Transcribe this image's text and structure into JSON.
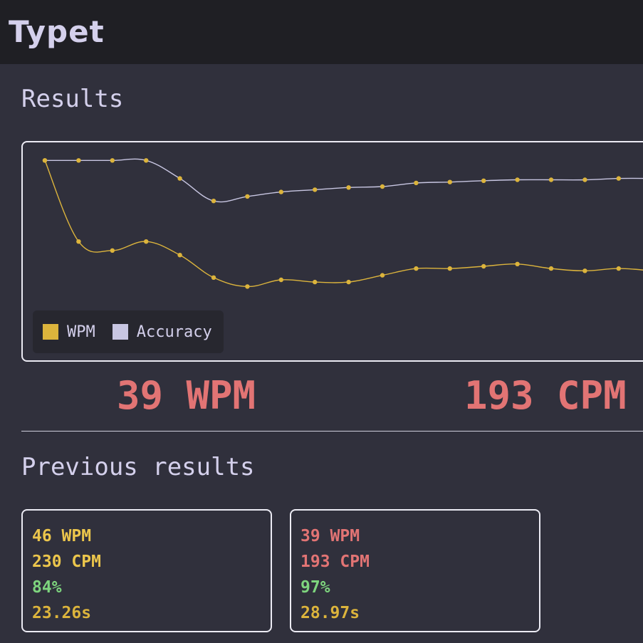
{
  "app": {
    "title": "Typet"
  },
  "results": {
    "title": "Results",
    "wpm_text": "39 WPM",
    "cpm_text": "193 CPM"
  },
  "colors": {
    "wpm": "#dcb43c",
    "accuracy": "#c8c6e2",
    "stat_red": "#e27474",
    "stat_yellow": "#ecc64c",
    "accuracy_green": "#7ed57e",
    "time_gold": "#dcb43c"
  },
  "chart_data": {
    "type": "line",
    "x": [
      1,
      2,
      3,
      4,
      5,
      6,
      7,
      8,
      9,
      10,
      11,
      12,
      13,
      14,
      15,
      16,
      17,
      18,
      19
    ],
    "series": [
      {
        "name": "Accuracy",
        "color": "#c8c6e2",
        "values": [
          100,
          100,
          100,
          100,
          96,
          91,
          92,
          93,
          93.5,
          94,
          94.2,
          95,
          95.2,
          95.5,
          95.7,
          95.7,
          95.7,
          96,
          96
        ]
      },
      {
        "name": "WPM",
        "color": "#dcb43c",
        "values": [
          100,
          82,
          80,
          82,
          79,
          74,
          72,
          73.5,
          73,
          73,
          74.5,
          76,
          76,
          76.5,
          77,
          76,
          75.5,
          76,
          75.5
        ]
      }
    ],
    "ylim": [
      55,
      104
    ],
    "legend": [
      {
        "label": "WPM",
        "color": "#dcb43c"
      },
      {
        "label": "Accuracy",
        "color": "#c8c6e2"
      }
    ],
    "legend_position": "bottom-left",
    "grid": false
  },
  "previous": {
    "title": "Previous results",
    "cards": [
      {
        "wpm": "46 WPM",
        "cpm": "230 CPM",
        "accuracy": "84%",
        "time": "23.26s",
        "speed_color": "#ecc64c"
      },
      {
        "wpm": "39 WPM",
        "cpm": "193 CPM",
        "accuracy": "97%",
        "time": "28.97s",
        "speed_color": "#e27474"
      }
    ]
  }
}
